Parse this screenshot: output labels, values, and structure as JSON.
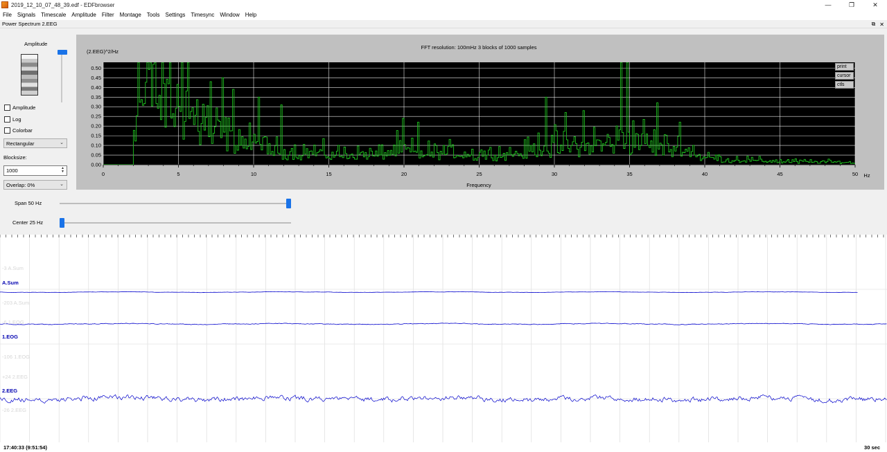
{
  "window": {
    "title": "2019_12_10_07_48_39.edf - EDFbrowser",
    "minimize": "—",
    "maximize": "❐",
    "close": "✕"
  },
  "menu": [
    "File",
    "Signals",
    "Timescale",
    "Amplitude",
    "Filter",
    "Montage",
    "Tools",
    "Settings",
    "Timesync",
    "Window",
    "Help"
  ],
  "dock": {
    "title": "Power Spectrum 2.EEG",
    "float_icon": "⧉",
    "close_icon": "✕"
  },
  "controls": {
    "amplitude_label": "Amplitude",
    "amplitude_slider_level": 1.0,
    "checkboxes": [
      {
        "label": "Amplitude",
        "checked": false
      },
      {
        "label": "Log",
        "checked": false
      },
      {
        "label": "Colorbar",
        "checked": false
      }
    ],
    "window_select": "Rectangular",
    "blocksize_label": "Blocksize:",
    "blocksize_value": "1000",
    "overlap_select": "Overlap: 0%",
    "span_label": "Span 50 Hz",
    "span_level": 1.0,
    "center_label": "Center 25 Hz",
    "center_level": 0.0
  },
  "plot_buttons": [
    "print",
    "cursor",
    "ctls"
  ],
  "chart_data": {
    "type": "line",
    "title": "FFT resolution: 100mHz   3 blocks of 1000 samples",
    "ylabel": "(2.EEG)^2/Hz",
    "xlabel": "Frequency",
    "xunit": "Hz",
    "xlim": [
      0,
      50
    ],
    "ylim": [
      0,
      0.53
    ],
    "xticks": [
      0,
      5,
      10,
      15,
      20,
      25,
      30,
      35,
      40,
      45,
      50
    ],
    "xtick_labels": [
      "0",
      "5",
      "10",
      "15",
      "20",
      "25",
      "30",
      "35",
      "40",
      "45",
      "50"
    ],
    "yticks": [
      0,
      0.05,
      0.1,
      0.15,
      0.2,
      0.25,
      0.3,
      0.35,
      0.4,
      0.45,
      0.5
    ],
    "ytick_labels": [
      "0.00",
      "0.05",
      "0.10",
      "0.15",
      "0.20",
      "0.25",
      "0.30",
      "0.35",
      "0.40",
      "0.45",
      "0.50"
    ],
    "grid": true,
    "series_color": "#1ec41e",
    "background": "#000000",
    "envelope": {
      "x": [
        0.0,
        1.9,
        2.0,
        2.5,
        3.0,
        3.5,
        4.0,
        4.5,
        5.0,
        5.5,
        6.0,
        6.5,
        7.0,
        7.5,
        8.0,
        8.5,
        9.0,
        9.5,
        10.0,
        10.5,
        11.0,
        11.5,
        12.0,
        12.5,
        13.0,
        14.0,
        15.0,
        16.0,
        17.0,
        18.0,
        19.0,
        19.5,
        20.0,
        21.0,
        22.0,
        23.0,
        24.0,
        25.0,
        26.0,
        27.0,
        28.0,
        29.0,
        29.5,
        30.0,
        31.0,
        32.0,
        33.0,
        34.0,
        34.5,
        35.0,
        35.5,
        36.0,
        36.5,
        37.0,
        38.0,
        39.0,
        40.0,
        41.0,
        42.0,
        43.0,
        44.0,
        45.0,
        46.0,
        47.0,
        48.0,
        49.0,
        50.0
      ],
      "y": [
        0.0,
        0.0,
        0.3,
        0.42,
        0.45,
        0.42,
        0.4,
        0.38,
        0.38,
        0.36,
        0.33,
        0.3,
        0.25,
        0.2,
        0.19,
        0.18,
        0.17,
        0.14,
        0.12,
        0.11,
        0.1,
        0.09,
        0.08,
        0.08,
        0.08,
        0.08,
        0.07,
        0.07,
        0.07,
        0.07,
        0.08,
        0.1,
        0.09,
        0.08,
        0.08,
        0.08,
        0.07,
        0.07,
        0.07,
        0.08,
        0.08,
        0.13,
        0.14,
        0.12,
        0.11,
        0.12,
        0.14,
        0.15,
        0.16,
        0.18,
        0.16,
        0.15,
        0.13,
        0.12,
        0.11,
        0.08,
        0.05,
        0.04,
        0.035,
        0.03,
        0.025,
        0.025,
        0.02,
        0.02,
        0.018,
        0.016,
        0.015
      ]
    },
    "peaks": [
      {
        "x": 2.3,
        "y": 0.53
      },
      {
        "x": 2.9,
        "y": 0.53
      },
      {
        "x": 3.4,
        "y": 0.53
      },
      {
        "x": 4.4,
        "y": 0.53
      },
      {
        "x": 5.2,
        "y": 0.53
      },
      {
        "x": 5.6,
        "y": 0.53
      },
      {
        "x": 7.1,
        "y": 0.43
      },
      {
        "x": 7.9,
        "y": 0.45
      },
      {
        "x": 8.6,
        "y": 0.39
      },
      {
        "x": 10.3,
        "y": 0.35
      },
      {
        "x": 11.8,
        "y": 0.31
      },
      {
        "x": 19.9,
        "y": 0.24
      },
      {
        "x": 20.9,
        "y": 0.22
      },
      {
        "x": 29.4,
        "y": 0.35
      },
      {
        "x": 30.7,
        "y": 0.27
      },
      {
        "x": 31.9,
        "y": 0.28
      },
      {
        "x": 34.4,
        "y": 0.53
      },
      {
        "x": 34.8,
        "y": 0.53
      },
      {
        "x": 36.8,
        "y": 0.32
      },
      {
        "x": 38.3,
        "y": 0.22
      },
      {
        "x": 39.2,
        "y": 0.1
      }
    ]
  },
  "signals": {
    "channels": [
      {
        "name": "A.Sum",
        "top_ghost": "-3 A.Sum",
        "bottom_ghost": "-203 A.Sum",
        "color": "#0000cc"
      },
      {
        "name": "1.EOG",
        "top_ghost": "-6 1.EOG",
        "bottom_ghost": "-106 1.EOG",
        "color": "#0000cc"
      },
      {
        "name": "2.EEG",
        "top_ghost": "+24 2.EEG",
        "bottom_ghost": "-26 2.EEG",
        "color": "#0000cc"
      }
    ],
    "time_left": "17:40:33 (9:51:54)",
    "time_right": "30 sec"
  }
}
